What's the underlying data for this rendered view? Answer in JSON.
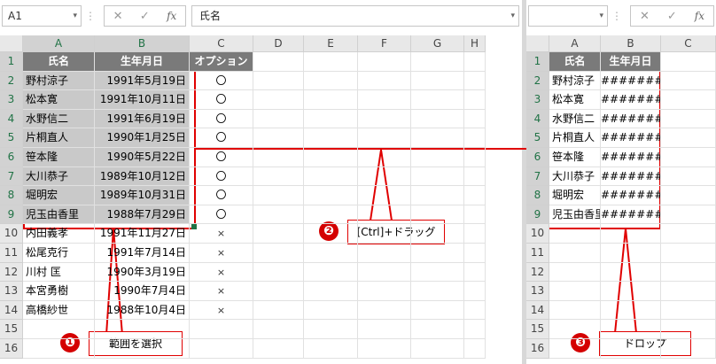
{
  "left": {
    "namebox": "A1",
    "formula": "氏名",
    "columns": [
      "A",
      "B",
      "C",
      "D",
      "E",
      "F",
      "G",
      "H"
    ],
    "rows": [
      "1",
      "2",
      "3",
      "4",
      "5",
      "6",
      "7",
      "8",
      "9",
      "10",
      "11",
      "12",
      "13",
      "14",
      "15",
      "16"
    ],
    "headers": [
      "氏名",
      "生年月日",
      "オプション"
    ],
    "data": [
      [
        "野村涼子",
        "1991年5月19日",
        "〇"
      ],
      [
        "松本寛",
        "1991年10月11日",
        "〇"
      ],
      [
        "水野信二",
        "1991年6月19日",
        "〇"
      ],
      [
        "片桐直人",
        "1990年1月25日",
        "〇"
      ],
      [
        "笹本隆",
        "1990年5月22日",
        "〇"
      ],
      [
        "大川恭子",
        "1989年10月12日",
        "〇"
      ],
      [
        "堀明宏",
        "1989年10月31日",
        "〇"
      ],
      [
        "児玉由香里",
        "1988年7月29日",
        "〇"
      ],
      [
        "内田義孝",
        "1991年11月27日",
        "×"
      ],
      [
        "松尾克行",
        "1991年7月14日",
        "×"
      ],
      [
        "川村 匡",
        "1990年3月19日",
        "×"
      ],
      [
        "本宮勇樹",
        "1990年7月4日",
        "×"
      ],
      [
        "高橋紗世",
        "1988年10月4日",
        "×"
      ]
    ]
  },
  "right": {
    "namebox": "",
    "columns": [
      "A",
      "B",
      "C"
    ],
    "rows": [
      "1",
      "2",
      "3",
      "4",
      "5",
      "6",
      "7",
      "8",
      "9",
      "10",
      "11",
      "12",
      "13",
      "14",
      "15",
      "16"
    ],
    "headers": [
      "氏名",
      "生年月日"
    ],
    "data": [
      [
        "野村涼子",
        "#######"
      ],
      [
        "松本寛",
        "#######"
      ],
      [
        "水野信二",
        "#######"
      ],
      [
        "片桐直人",
        "#######"
      ],
      [
        "笹本隆",
        "#######"
      ],
      [
        "大川恭子",
        "#######"
      ],
      [
        "堀明宏",
        "#######"
      ],
      [
        "児玉由香里",
        "#######"
      ]
    ]
  },
  "icons": {
    "cancel": "✕",
    "enter": "✓",
    "function": "fx",
    "dropdown": "▾",
    "more": "⋮"
  },
  "callouts": {
    "step1": {
      "number": "❶",
      "label": "範囲を選択"
    },
    "step2": {
      "number": "❷",
      "label": "[Ctrl]+ドラッグ"
    },
    "step3": {
      "number": "❸",
      "label": "ドロップ"
    }
  },
  "colors": {
    "annotation": "#e00000",
    "header_fill": "#7a7a7a",
    "selection_fill": "#c9c9c9",
    "excel_green": "#217346"
  }
}
